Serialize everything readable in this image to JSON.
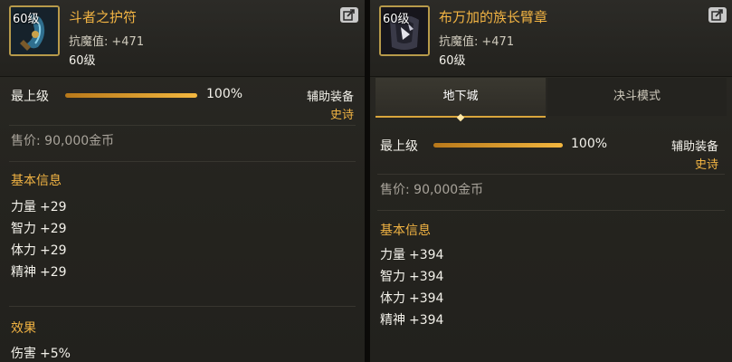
{
  "left": {
    "level_badge": "60级",
    "name": "斗者之护符",
    "stat_label": "抗魔值:",
    "stat_value": "+471",
    "level": "60级",
    "grade_label": "最上级",
    "grade_percent": "100%",
    "grade_fill": 1.0,
    "equip_type": "辅助装备",
    "rarity": "史诗",
    "price": "售价: 90,000金币",
    "basic_title": "基本信息",
    "stats": [
      {
        "name": "力量",
        "value": "+29"
      },
      {
        "name": "智力",
        "value": "+29"
      },
      {
        "name": "体力",
        "value": "+29"
      },
      {
        "name": "精神",
        "value": "+29"
      }
    ],
    "effect_title": "效果",
    "effect": {
      "name": "伤害",
      "value": "+5%"
    }
  },
  "right": {
    "level_badge": "60级",
    "name": "布万加的族长臂章",
    "stat_label": "抗魔值:",
    "stat_value": "+471",
    "level": "60级",
    "tabs": [
      {
        "label": "地下城",
        "active": true
      },
      {
        "label": "决斗模式",
        "active": false
      }
    ],
    "grade_label": "最上级",
    "grade_percent": "100%",
    "grade_fill": 1.0,
    "equip_type": "辅助装备",
    "rarity": "史诗",
    "price": "售价: 90,000金币",
    "basic_title": "基本信息",
    "stats": [
      {
        "name": "力量",
        "value": "+394"
      },
      {
        "name": "智力",
        "value": "+394"
      },
      {
        "name": "体力",
        "value": "+394"
      },
      {
        "name": "精神",
        "value": "+394"
      }
    ]
  },
  "colors": {
    "accent": "#f2b443",
    "panel_bg": "#25241f",
    "text": "#f3f1ea"
  },
  "icons": {
    "share": "share-icon",
    "left_item": "amulet-icon",
    "right_item": "armband-icon"
  }
}
